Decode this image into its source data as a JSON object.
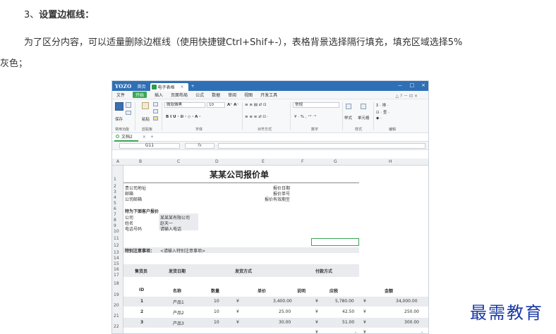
{
  "heading": {
    "num": "3、",
    "text": "设置边框线："
  },
  "paragraph": {
    "line1": "为了区分内容，可以适量删除边框线（使用快捷键Ctrl+Shif+-），表格背景选择隔行填充，填充区域选择5%",
    "line2": "灰色；"
  },
  "window": {
    "logo": "YOZO",
    "home": "首页",
    "tab": "电子表格",
    "tab_close": "×",
    "plus": "+",
    "controls": [
      "－",
      "□",
      "×"
    ],
    "menu": [
      "文件",
      "开始",
      "插入",
      "页面布局",
      "公式",
      "数据",
      "审阅",
      "视图",
      "开发工具"
    ],
    "menu_right": "△ ? － ⊡ ×"
  },
  "ribbon": {
    "groups": [
      "常用功能",
      "剪贴板",
      "字体",
      "对齐方式",
      "数字",
      "样式",
      "编辑"
    ],
    "save": "保存",
    "paste": "粘贴",
    "font_name": "微软雅黑",
    "font_size": "10",
    "number_format": "常规",
    "style_label": "样式",
    "cell_label": "单元格"
  },
  "sheet": {
    "tab": "文档2",
    "add": "+",
    "close": "×"
  },
  "formula": {
    "namebox": "G11",
    "fx": "fx"
  },
  "columns": [
    "A",
    "B",
    "C",
    "D",
    "E",
    "F",
    "G",
    "H"
  ],
  "rows": [
    "1",
    "2",
    "3",
    "4",
    "5",
    "6",
    "7",
    "8",
    "9",
    "10",
    "11",
    "12",
    "13",
    "14",
    "15",
    "16",
    "17",
    "18",
    "19",
    "20",
    "21",
    "22"
  ],
  "doc": {
    "title": "某某公司报价单",
    "company_address": "贵公司地址",
    "email": "邮箱",
    "company_email": "公司邮箱",
    "quote_date": "报价日期",
    "quote_no": "报价单号",
    "valid_until": "报价有效期至",
    "customer_header": "特为下面客户报价",
    "company_label": "公司",
    "company_value": "某某某有限公司",
    "name_label": "姓名",
    "name_value": "赵天一",
    "phone_label": "电话号码",
    "phone_value": "请输入电话",
    "notes_label": "特别注意事项：",
    "notes_value": "<请输入特别注意事项>",
    "seller": "售货员",
    "ship_date": "发货日期",
    "ship_method": "发货方式",
    "pay_method": "付款方式",
    "headers": [
      "ID",
      "名称",
      "数量",
      "单价",
      "说明",
      "应税",
      "金额"
    ],
    "items": [
      {
        "id": "1",
        "name": "产品1",
        "qty": "10",
        "cur": "¥",
        "price": "3,400.00",
        "cur2": "¥",
        "tax": "5,780.00",
        "cur3": "¥",
        "amount": "34,000.00"
      },
      {
        "id": "2",
        "name": "产品2",
        "qty": "10",
        "cur": "¥",
        "price": "25.00",
        "cur2": "¥",
        "tax": "42.50",
        "cur3": "¥",
        "amount": "250.00"
      },
      {
        "id": "3",
        "name": "产品3",
        "qty": "10",
        "cur": "¥",
        "price": "30.00",
        "cur2": "¥",
        "tax": "51.00",
        "cur3": "¥",
        "amount": "300.00"
      }
    ],
    "row22": {
      "cur": "¥",
      "dash": "-",
      "cur2": "¥",
      "dash2": "-"
    }
  },
  "watermark": "最需教育"
}
